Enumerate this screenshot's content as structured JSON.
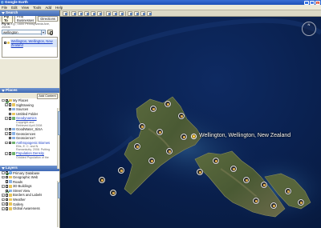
{
  "window": {
    "title": "Google Earth"
  },
  "menu": [
    "File",
    "Edit",
    "View",
    "Tools",
    "Add",
    "Help"
  ],
  "search": {
    "header": "Search",
    "tabs": [
      "Fly To",
      "Find Businesses",
      "Directions"
    ],
    "hint_prefix": "Fly to",
    "hint_example": "e.g., 1600 Pennsylvania Ave, 20006",
    "query": "wellington",
    "result": "Wellington, Wellington, New Zealand"
  },
  "places": {
    "header": "Places",
    "add_content": "Add Content",
    "items": [
      {
        "label": "My Places",
        "expand": "-",
        "checked": true,
        "icon": "folder",
        "link": false,
        "indent": 0
      },
      {
        "label": "Sightseeing",
        "expand": "+",
        "checked": false,
        "icon": "folder",
        "link": false,
        "indent": 1
      },
      {
        "label": "Sources",
        "expand": "",
        "checked": false,
        "icon": "kml",
        "link": false,
        "indent": 1
      },
      {
        "label": "Untitled Folder",
        "expand": "",
        "checked": false,
        "icon": "folder",
        "link": false,
        "indent": 1
      },
      {
        "label": "Geodynamics",
        "expand": "+",
        "checked": false,
        "icon": "net",
        "link": true,
        "indent": 1,
        "desc": [
          "Copyright and",
          "Retrieved April 2008"
        ]
      },
      {
        "label": "GoodWater_SiSA",
        "expand": "+",
        "checked": false,
        "icon": "kml",
        "link": false,
        "indent": 1
      },
      {
        "label": "Geosciences",
        "expand": "+",
        "checked": false,
        "icon": "kml",
        "link": false,
        "indent": 1
      },
      {
        "label": "Geoscience?",
        "expand": "",
        "checked": false,
        "icon": "kml",
        "link": false,
        "indent": 1
      },
      {
        "label": "Anthropogenic Biomes",
        "expand": "+",
        "checked": false,
        "icon": "net",
        "link": true,
        "indent": 1,
        "desc": [
          "Ellis, E. C. and N.",
          "Ramankutty. 2008. Putting"
        ]
      },
      {
        "label": "Population Density",
        "expand": "+",
        "checked": false,
        "icon": "net",
        "link": true,
        "indent": 1,
        "desc": [
          "Gridded Population of the",
          "World (GPW), Version 3.0"
        ]
      },
      {
        "label": "Earthquakes",
        "expand": "+",
        "checked": false,
        "icon": "net",
        "link": true,
        "indent": 1,
        "desc": [
          "Select this folder and click"
        ]
      }
    ]
  },
  "layers": {
    "header": "Layers",
    "items": [
      {
        "label": "Primary Database",
        "expand": "-",
        "checked": true,
        "icon": "globe"
      },
      {
        "label": "Geographic Web",
        "expand": "+",
        "checked": false,
        "icon": "folder"
      },
      {
        "label": "Roads",
        "expand": "",
        "checked": false,
        "icon": "kml"
      },
      {
        "label": "3D Buildings",
        "expand": "+",
        "checked": false,
        "icon": "folder"
      },
      {
        "label": "Street View",
        "expand": "",
        "checked": true,
        "icon": "kml"
      },
      {
        "label": "Borders and Labels",
        "expand": "+",
        "checked": false,
        "icon": "folder"
      },
      {
        "label": "Weather",
        "expand": "+",
        "checked": false,
        "icon": "folder"
      },
      {
        "label": "Gallery",
        "expand": "+",
        "checked": false,
        "icon": "folder"
      },
      {
        "label": "Global Awareness",
        "expand": "+",
        "checked": false,
        "icon": "folder"
      }
    ]
  },
  "map": {
    "place_label": "Wellington, Wellington, New Zealand"
  }
}
